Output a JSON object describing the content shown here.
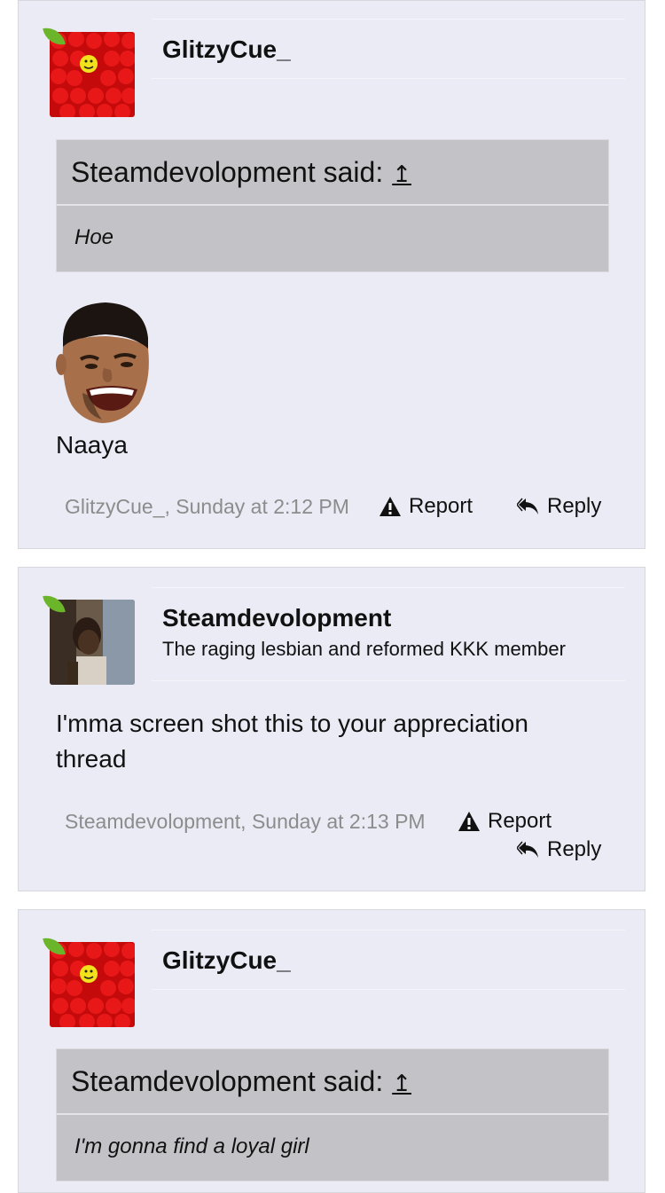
{
  "posts": [
    {
      "username": "GlitzyCue_",
      "quote": {
        "header": "Steamdevolopment said:",
        "arrow": "↥",
        "text": "Hoe"
      },
      "message": "Naaya",
      "meta": "GlitzyCue_, Sunday at 2:12 PM",
      "report_label": "Report",
      "reply_label": "Reply"
    },
    {
      "username": "Steamdevolopment",
      "user_title": "The raging lesbian and reformed KKK member",
      "message_line1": "I'mma screen shot this to your appreciation",
      "message_line2": "thread",
      "meta": "Steamdevolopment, Sunday at 2:13 PM",
      "report_label": "Report",
      "reply_label": "Reply"
    },
    {
      "username": "GlitzyCue_",
      "quote": {
        "header": "Steamdevolopment said:",
        "arrow": "↥",
        "text": "I'm gonna find a loyal girl"
      }
    }
  ],
  "icons": [
    "warning-icon",
    "reply-icon",
    "leaf-badge-icon"
  ],
  "colors": {
    "post_bg": "#ebebf6",
    "quote_bg": "#c3c3c7",
    "meta_text": "#8c8c8c",
    "badge": "#6bb52b"
  }
}
